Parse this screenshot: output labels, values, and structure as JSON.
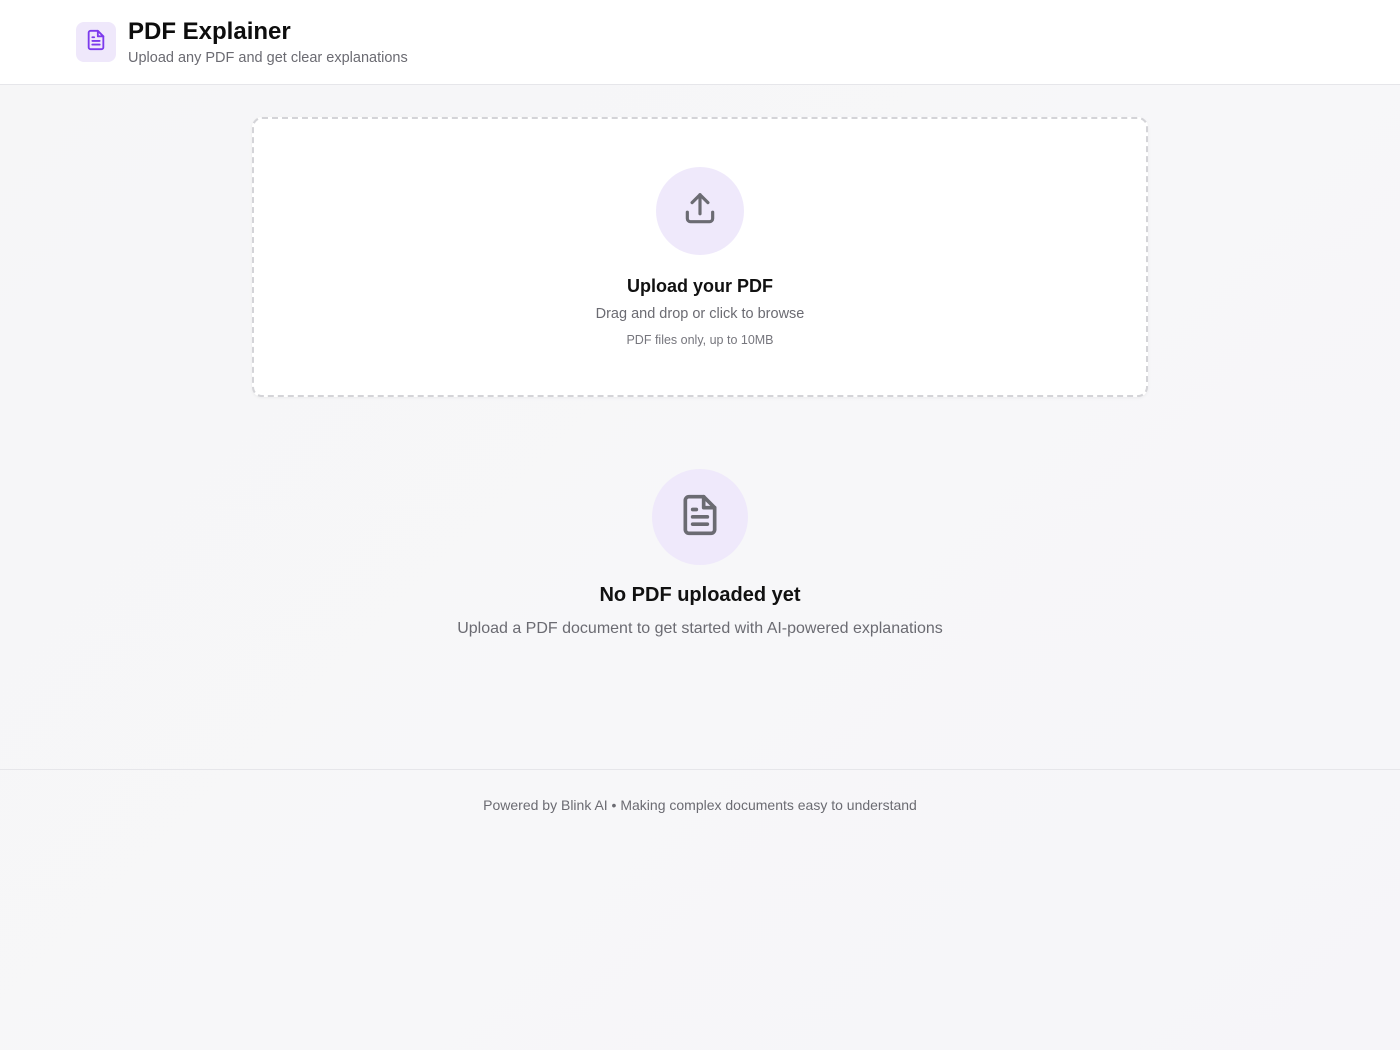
{
  "header": {
    "title": "PDF Explainer",
    "subtitle": "Upload any PDF and get clear explanations",
    "logo_icon": "file-text-icon"
  },
  "upload": {
    "icon": "upload-icon",
    "title": "Upload your PDF",
    "hint": "Drag and drop or click to browse",
    "limit": "PDF files only, up to 10MB"
  },
  "empty_state": {
    "icon": "file-text-icon",
    "title": "No PDF uploaded yet",
    "description": "Upload a PDF document to get started with AI-powered explanations"
  },
  "footer": {
    "text": "Powered by Blink AI • Making complex documents easy to understand"
  },
  "colors": {
    "accent": "#7c3aed",
    "accent_light": "#efe9fb",
    "icon_gray": "#6b6b72",
    "border": "#d4d4d8"
  }
}
